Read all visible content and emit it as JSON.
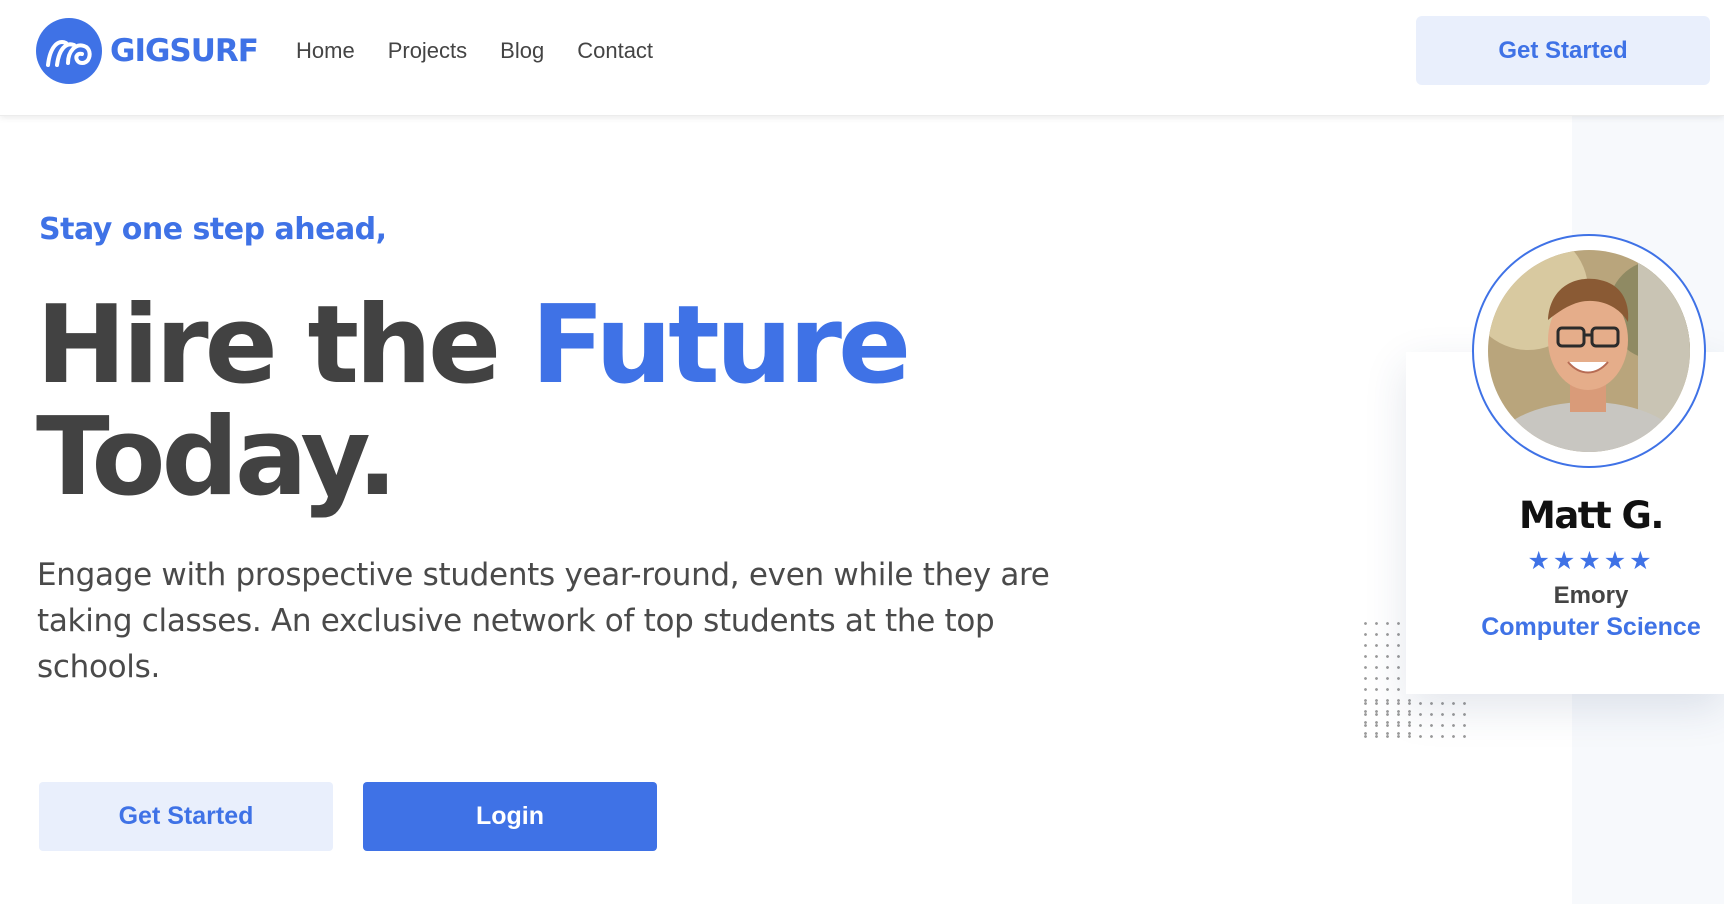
{
  "brand": {
    "name": "GIGSURF",
    "accent_color": "#3f72e6",
    "logo_icon": "wave-icon"
  },
  "nav": {
    "items": [
      "Home",
      "Projects",
      "Blog",
      "Contact"
    ]
  },
  "header": {
    "cta_label": "Get Started"
  },
  "hero": {
    "eyebrow": "Stay one step ahead,",
    "headline_part1": "Hire the ",
    "headline_accent": "Future",
    "headline_part2": "Today.",
    "subtext": "Engage with prospective students year-round, even while they are taking classes. An exclusive network of top students at the top schools.",
    "primary_button": "Get Started",
    "secondary_button": "Login"
  },
  "profile_card": {
    "name": "Matt G.",
    "rating": 5,
    "stars": "★★★★★",
    "school": "Emory",
    "major": "Computer Science"
  }
}
